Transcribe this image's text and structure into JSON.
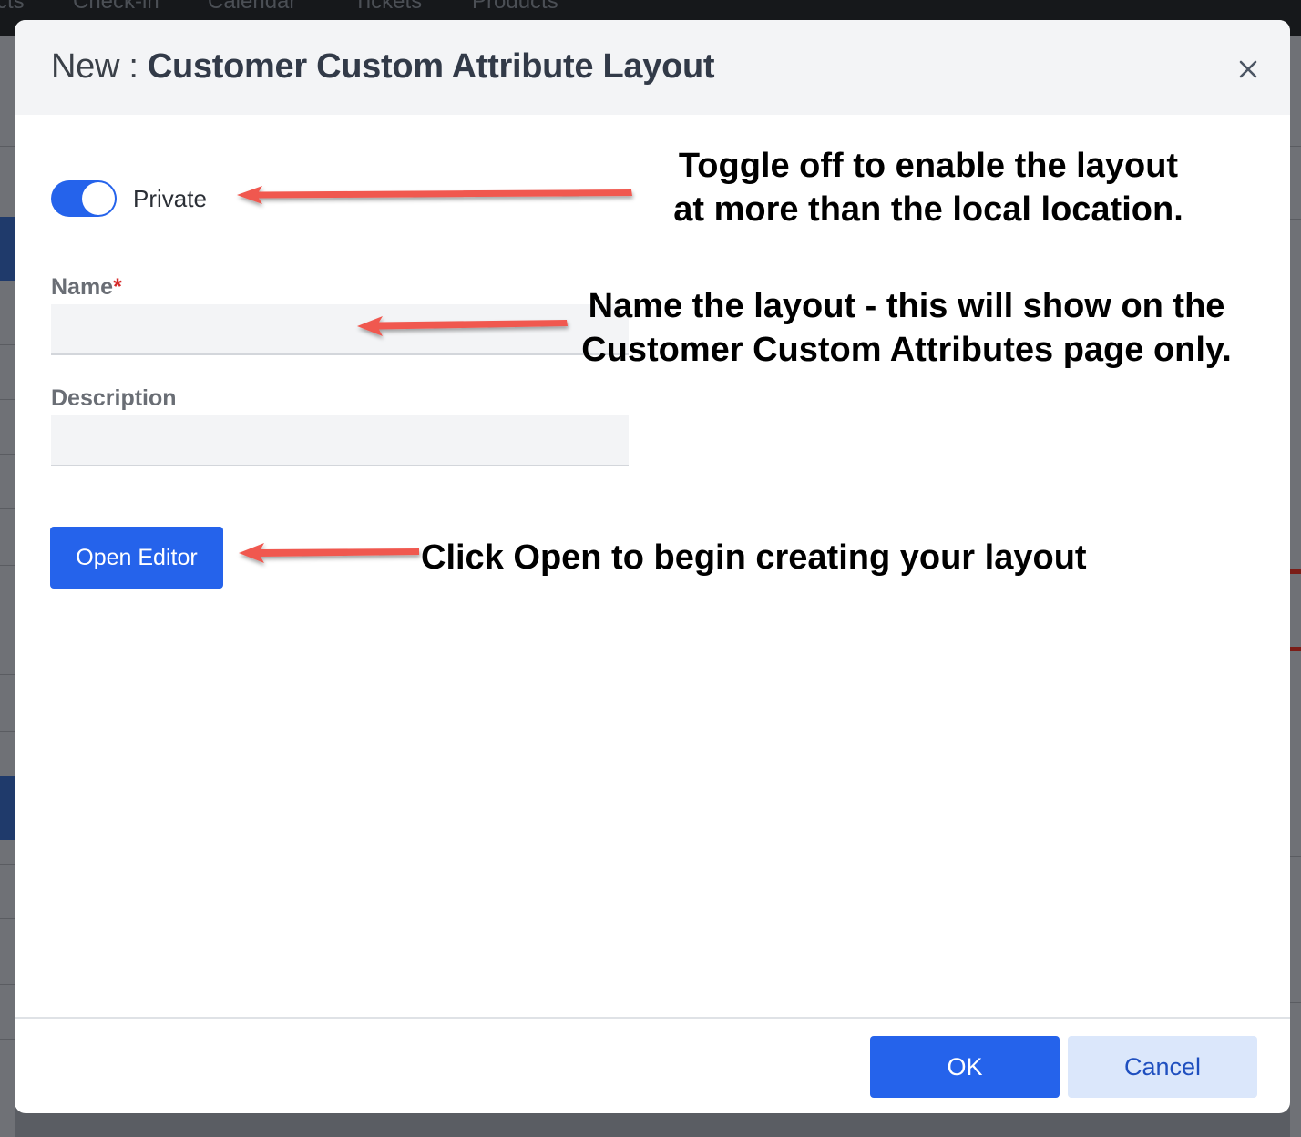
{
  "background_nav": {
    "items": [
      "cts",
      "Check-in",
      "Calendar",
      "Tickets",
      "Products"
    ]
  },
  "modal": {
    "title_prefix": "New : ",
    "title": "Customer Custom Attribute Layout",
    "close_icon": "close-icon",
    "private_toggle": {
      "label": "Private",
      "on": true
    },
    "name_field": {
      "label": "Name",
      "required_marker": "*",
      "value": ""
    },
    "description_field": {
      "label": "Description",
      "value": ""
    },
    "open_editor_label": "Open Editor",
    "ok_label": "OK",
    "cancel_label": "Cancel"
  },
  "annotations": {
    "toggle_line1": "Toggle off to enable the layout",
    "toggle_line2": "at more than the local location.",
    "name_line1": "Name the layout - this will show on the",
    "name_line2": "Customer Custom Attributes page only.",
    "editor_line1": "Click Open to begin creating your layout"
  },
  "colors": {
    "primary": "#2563eb",
    "arrow": "#f0584f",
    "required": "#d62a2a",
    "cancel_bg": "#dbe7fb"
  }
}
